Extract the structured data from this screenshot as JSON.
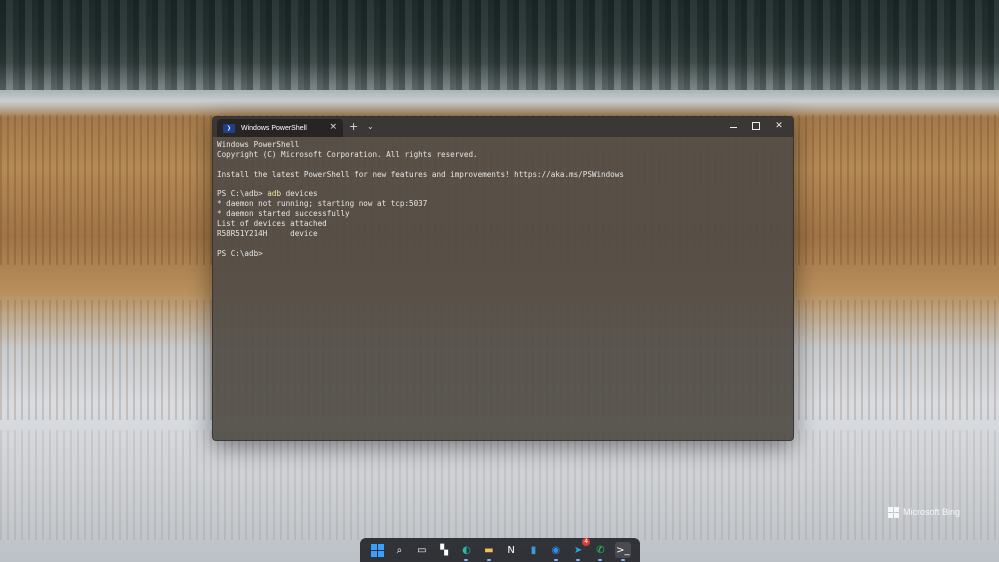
{
  "wallpaper": {
    "branding": "Microsoft Bing"
  },
  "terminal": {
    "tab_title": "Windows PowerShell",
    "tab_icon": "powershell-icon",
    "tab_close": "×",
    "new_tab": "+",
    "dropdown": "⌄",
    "controls": {
      "close": "✕"
    },
    "lines": [
      {
        "text": "Windows PowerShell"
      },
      {
        "text": "Copyright (C) Microsoft Corporation. All rights reserved."
      },
      {
        "text": ""
      },
      {
        "text": "Install the latest PowerShell for new features and improvements! https://aka.ms/PSWindows"
      },
      {
        "text": ""
      },
      {
        "prompt": "PS C:\\adb> ",
        "cmd": "adb",
        "rest": " devices"
      },
      {
        "text": "* daemon not running; starting now at tcp:5037"
      },
      {
        "text": "* daemon started successfully"
      },
      {
        "text": "List of devices attached"
      },
      {
        "text": "R58R51Y214H     device"
      },
      {
        "text": ""
      },
      {
        "text": "PS C:\\adb>"
      }
    ]
  },
  "taskbar": {
    "items": [
      {
        "name": "start-icon"
      },
      {
        "name": "search-icon",
        "glyph": "⌕"
      },
      {
        "name": "task-view-icon",
        "glyph": "▭"
      },
      {
        "name": "widgets-icon",
        "glyph": "▚"
      },
      {
        "name": "edge-icon",
        "glyph": "◐",
        "color": "#2fb6a8"
      },
      {
        "name": "file-explorer-icon",
        "glyph": "▬",
        "color": "#f2c14e"
      },
      {
        "name": "notion-icon",
        "glyph": "N"
      },
      {
        "name": "notepad-icon",
        "glyph": "▮",
        "color": "#3a9bdc"
      },
      {
        "name": "browser-icon",
        "glyph": "◉",
        "color": "#2d8cf0"
      },
      {
        "name": "telegram-icon",
        "glyph": "➤",
        "color": "#2aa4e0",
        "badge": "4"
      },
      {
        "name": "whatsapp-icon",
        "glyph": "✆",
        "color": "#25d366"
      },
      {
        "name": "terminal-icon",
        "glyph": ">_"
      }
    ]
  }
}
